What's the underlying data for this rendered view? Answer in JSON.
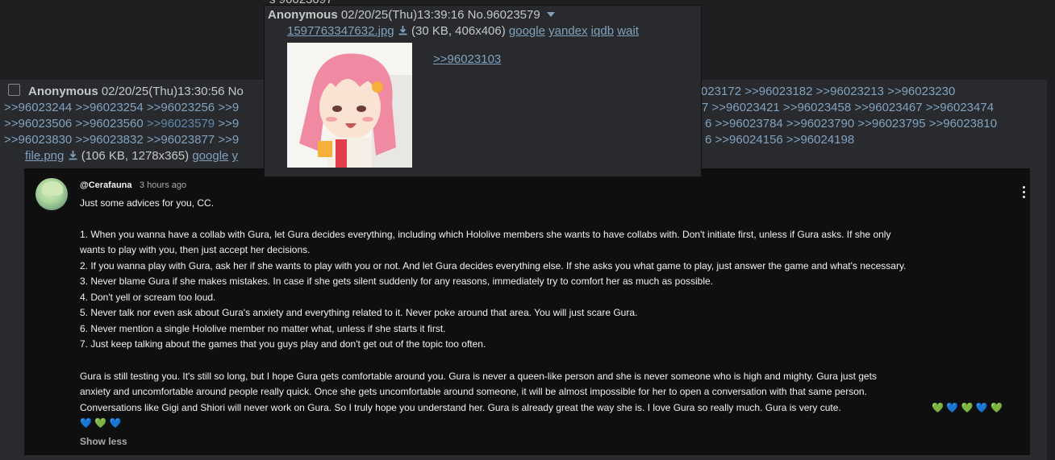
{
  "top_fragment": "s 96023097",
  "reply": {
    "name": "Anonymous",
    "datetime": "02/20/25(Thu)13:30:56 No",
    "header_tail": "023172 >>96023182 >>96023213 >>96023230",
    "backlinks_row1": [
      ">>96023244",
      ">>96023254",
      ">>96023256",
      ">>9"
    ],
    "backlinks_row1_tail": "7 >>96023421 >>96023458 >>96023467 >>96023474",
    "backlinks_row2": [
      ">>96023506",
      ">>96023560",
      ">>96023579",
      ">>9"
    ],
    "backlinks_row2_tail": "6 >>96023784 >>96023790 >>96023795 >>96023810",
    "backlinks_row3": [
      ">>96023830",
      ">>96023832",
      ">>96023877",
      ">>9"
    ],
    "backlinks_row3_tail": "6 >>96024156 >>96024198",
    "file_name": "file.png",
    "file_info": "(106 KB, 1278x365)",
    "file_link_google": "google",
    "file_link_trunc": "y"
  },
  "popup": {
    "name": "Anonymous",
    "datetime": "02/20/25(Thu)13:39:16 No.96023579",
    "file_name": "1597763347632.jpg",
    "file_info": "(30 KB, 406x406)",
    "links": [
      "google",
      "yandex",
      "iqdb",
      "wait"
    ],
    "quote": ">>96023103"
  },
  "youtube_comment": {
    "author": "@Cerafauna",
    "time": "3 hours ago",
    "lines": [
      "Just some advices for you, CC.",
      "",
      "1. When you wanna have a collab with Gura, let Gura decides everything, including which Hololive members she wants to have collabs with. Don't initiate first, unless if Gura asks. If she only",
      "wants to play with you, then just accept her decisions.",
      "2. If you wanna play with Gura, ask her if she wants to play with you or not. And let Gura decides everything else. If she asks you what game to play, just answer the game and what's necessary.",
      "3. Never blame Gura if she makes mistakes. In case if she gets silent suddenly for any reasons, immediately try to comfort her as much as possible.",
      "4. Don't yell or scream too loud.",
      "5. Never talk nor even ask about Gura's anxiety and everything related to it. Never poke around that area. You will just scare Gura.",
      "6. Never mention a single Hololive member no matter what, unless if she starts it first.",
      "7. Just keep talking about the games that you guys play and don't get out of the topic too often.",
      "",
      "Gura is still testing you. It's still so long, but I hope Gura gets comfortable around you. Gura is never a queen-like person and she is never someone who is high and mighty. Gura just gets",
      "anxiety and uncomfortable around people really quick. Once she gets uncomfortable around someone, it will be almost impossible for her to open a conversation with that same person.",
      "Conversations like Gigi and Shiori will never work on Gura. So I truly hope you understand her. Gura is already great the way she is. I love Gura so really much. Gura is very cute."
    ],
    "emoji_row1": "💚 💙 💚 💙 💚",
    "emoji_row2": "💙 💚 💙",
    "show_less": "Show less"
  },
  "colors": {
    "bg": "#1d1f21",
    "post_bg": "#282a2e",
    "link": "#81a2be",
    "text": "#c5c8c6",
    "yt_bg": "#0f0f0f"
  }
}
